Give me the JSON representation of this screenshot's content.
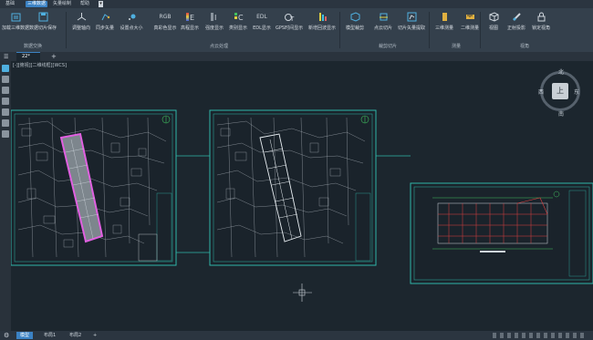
{
  "menu": {
    "tabs": [
      {
        "label": "基础"
      },
      {
        "label": "三维数据"
      },
      {
        "label": "矢量绘制"
      },
      {
        "label": "帮助"
      }
    ]
  },
  "ribbon": {
    "buttons": [
      {
        "label": "加载三维数据",
        "icon": "open-3d-icon"
      },
      {
        "label": "数据切片保存",
        "icon": "slice-save-icon"
      },
      {
        "label": "调整轴向",
        "icon": "axis-icon"
      },
      {
        "label": "同步矢量",
        "icon": "sync-vector-icon"
      },
      {
        "label": "设置点大小",
        "icon": "point-size-icon"
      },
      {
        "label": "真彩色显示",
        "icon": "rgb-icon",
        "text": "RGB"
      },
      {
        "label": "高程显示",
        "icon": "elevation-icon",
        "text": "E"
      },
      {
        "label": "强度显示",
        "icon": "intensity-icon",
        "text": "I"
      },
      {
        "label": "类别显示",
        "icon": "class-icon",
        "text": "C"
      },
      {
        "label": "EDL显示",
        "icon": "edl-icon",
        "text": "EDL"
      },
      {
        "label": "GPS时间显示",
        "icon": "gps-time-icon",
        "text": "T"
      },
      {
        "label": "新增回波显示",
        "icon": "echo-icon"
      },
      {
        "label": "模型裁剪",
        "icon": "model-crop-icon"
      },
      {
        "label": "点云切片",
        "icon": "pc-slice-icon"
      },
      {
        "label": "切片矢量提取",
        "icon": "slice-vector-icon"
      },
      {
        "label": "三维测量",
        "icon": "measure-3d-icon"
      },
      {
        "label": "二维测量",
        "icon": "measure-2d-icon"
      },
      {
        "label": "视图",
        "icon": "view-icon"
      },
      {
        "label": "正射投影",
        "icon": "ortho-icon"
      },
      {
        "label": "锁定视角",
        "icon": "lock-view-icon"
      }
    ],
    "groups": [
      {
        "label": "数据交换"
      },
      {
        "label": "点云处理"
      },
      {
        "label": "裁剪切片"
      },
      {
        "label": "测量"
      },
      {
        "label": "视角"
      }
    ]
  },
  "doc": {
    "tab": "22*",
    "add": "+",
    "view_label": "[-][俯视][二维线框][WCS]"
  },
  "compass": {
    "north": "北",
    "south": "南",
    "east": "东",
    "west": "西",
    "face": "上"
  },
  "status": {
    "tabs": [
      {
        "label": "模型"
      },
      {
        "label": "布局1"
      },
      {
        "label": "布局2"
      }
    ],
    "add": "+"
  },
  "colors": {
    "accent": "#3b82c4",
    "drawing_border": "#2fb6a8",
    "highlight": "#e060e0",
    "canvas": "#1c262e"
  }
}
